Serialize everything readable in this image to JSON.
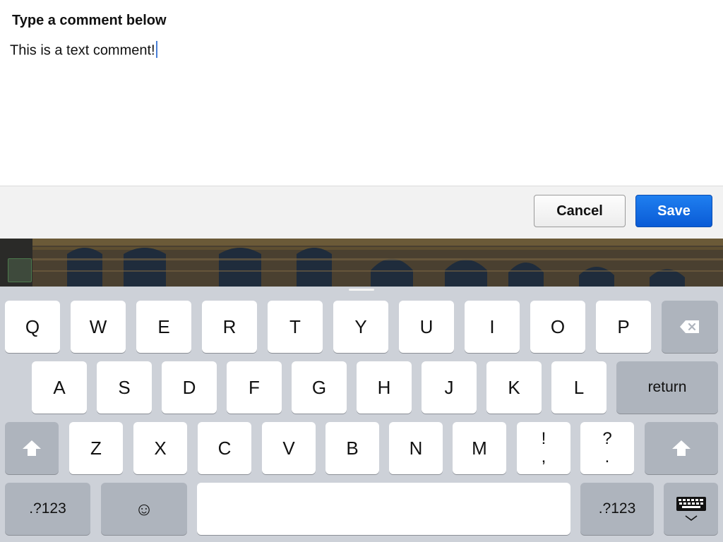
{
  "dialog": {
    "title": "Type a comment below",
    "comment_text": "This is a text comment!",
    "cancel_label": "Cancel",
    "save_label": "Save"
  },
  "keyboard": {
    "row1": [
      "Q",
      "W",
      "E",
      "R",
      "T",
      "Y",
      "U",
      "I",
      "O",
      "P"
    ],
    "row2": [
      "A",
      "S",
      "D",
      "F",
      "G",
      "H",
      "J",
      "K",
      "L"
    ],
    "row3": [
      "Z",
      "X",
      "C",
      "V",
      "B",
      "N",
      "M"
    ],
    "punct1": {
      "top": "!",
      "bottom": ","
    },
    "punct2": {
      "top": "?",
      "bottom": "."
    },
    "return_label": "return",
    "numbers_label": ".?123",
    "emoji": "☺",
    "icons": {
      "backspace": "backspace-icon",
      "shift": "shift-icon",
      "dismiss": "keyboard-dismiss-icon"
    }
  },
  "colors": {
    "save_button": "#0a5bd6",
    "caret": "#4a7fd6",
    "keyboard_bg": "#cdd1d8"
  }
}
